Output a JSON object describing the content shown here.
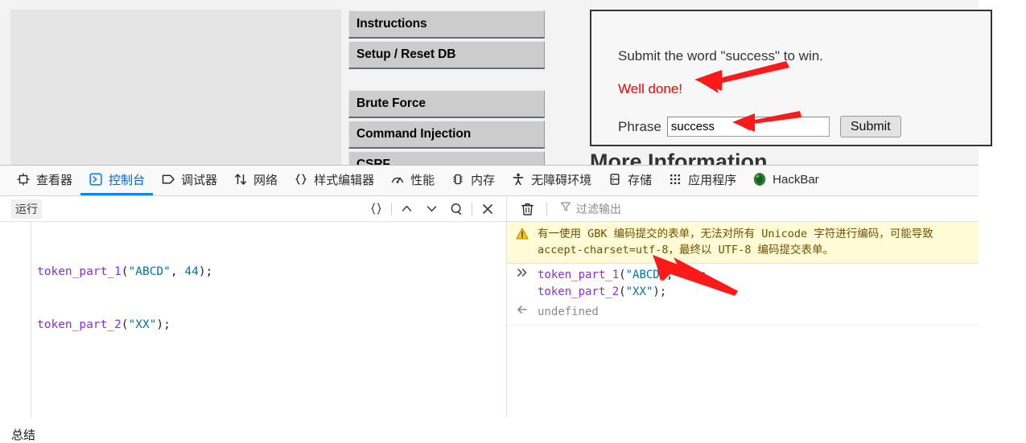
{
  "page": {
    "nav": {
      "group1": [
        {
          "label": "Instructions",
          "name": "nav-instructions"
        },
        {
          "label": "Setup / Reset DB",
          "name": "nav-setup-reset-db"
        }
      ],
      "group2": [
        {
          "label": "Brute Force",
          "name": "nav-brute-force"
        },
        {
          "label": "Command Injection",
          "name": "nav-command-injection"
        },
        {
          "label": "CSRF",
          "name": "nav-csrf"
        }
      ]
    },
    "content": {
      "instruction": "Submit the word \"success\" to win.",
      "result_message": "Well done!",
      "result_color": "#ff0000",
      "phrase_label": "Phrase",
      "phrase_value": "success",
      "phrase_placeholder": "",
      "submit_label": "Submit",
      "more_info_heading": "More Information"
    }
  },
  "devtools": {
    "tabs": [
      {
        "label": "查看器",
        "icon": "inspector-icon",
        "active": false
      },
      {
        "label": "控制台",
        "icon": "console-icon",
        "active": true
      },
      {
        "label": "调试器",
        "icon": "debugger-icon",
        "active": false
      },
      {
        "label": "网络",
        "icon": "network-icon",
        "active": false
      },
      {
        "label": "样式编辑器",
        "icon": "style-editor-icon",
        "active": false
      },
      {
        "label": "性能",
        "icon": "performance-icon",
        "active": false
      },
      {
        "label": "内存",
        "icon": "memory-icon",
        "active": false
      },
      {
        "label": "无障碍环境",
        "icon": "accessibility-icon",
        "active": false
      },
      {
        "label": "存储",
        "icon": "storage-icon",
        "active": false
      },
      {
        "label": "应用程序",
        "icon": "application-icon",
        "active": false
      },
      {
        "label": "HackBar",
        "icon": "hackbar-icon",
        "active": false
      }
    ],
    "editor_toolbar": {
      "run_label": "运行",
      "buttons": [
        {
          "name": "pretty-print-icon",
          "glyph": "{ }"
        },
        {
          "name": "history-prev-icon",
          "glyph": "chevron-up"
        },
        {
          "name": "history-next-icon",
          "glyph": "chevron-down"
        },
        {
          "name": "search-icon",
          "glyph": "magnifier"
        },
        {
          "name": "close-editor-icon",
          "glyph": "close"
        }
      ]
    },
    "output_toolbar": {
      "trash_name": "clear-console-icon",
      "filter_icon": "filter-icon",
      "filter_placeholder": "过滤输出",
      "filter_value": ""
    },
    "editor": {
      "lines": [
        [
          {
            "t": "token_part_1",
            "c": "fn"
          },
          {
            "t": "(",
            "c": "pun"
          },
          {
            "t": "\"ABCD\"",
            "c": "str"
          },
          {
            "t": ", ",
            "c": "pun"
          },
          {
            "t": "44",
            "c": "num"
          },
          {
            "t": ");",
            "c": "pun"
          }
        ],
        [
          {
            "t": "token_part_2",
            "c": "fn"
          },
          {
            "t": "(",
            "c": "pun"
          },
          {
            "t": "\"XX\"",
            "c": "str"
          },
          {
            "t": ");",
            "c": "pun"
          }
        ]
      ]
    },
    "console_messages": {
      "warning": {
        "icon": "warning-icon",
        "line1": "有一使用 GBK 编码提交的表单，无法对所有 Unicode 字符进行编码，可能导致",
        "line2": "accept-charset=utf-8，最终以 UTF-8 编码提交表单。"
      },
      "input": {
        "icon": "input-arrow-icon",
        "lines": [
          [
            {
              "t": "token_part_1",
              "c": "fn"
            },
            {
              "t": "(",
              "c": "pun"
            },
            {
              "t": "\"ABCD\"",
              "c": "str"
            },
            {
              "t": ", ",
              "c": "pun"
            },
            {
              "t": "44",
              "c": "num"
            },
            {
              "t": ");",
              "c": "pun"
            }
          ],
          [
            {
              "t": "token_part_2",
              "c": "fn"
            },
            {
              "t": "(",
              "c": "pun"
            },
            {
              "t": "\"XX\"",
              "c": "str"
            },
            {
              "t": ");",
              "c": "pun"
            }
          ]
        ]
      },
      "result": {
        "icon": "return-arrow-icon",
        "value": "undefined"
      }
    }
  },
  "bottom": {
    "text": "总结"
  },
  "annotations": {
    "arrow_color": "#ff1a1a",
    "arrows": [
      {
        "name": "arrow-to-well-done"
      },
      {
        "name": "arrow-to-phrase-input"
      },
      {
        "name": "arrow-to-console-xx"
      }
    ]
  }
}
